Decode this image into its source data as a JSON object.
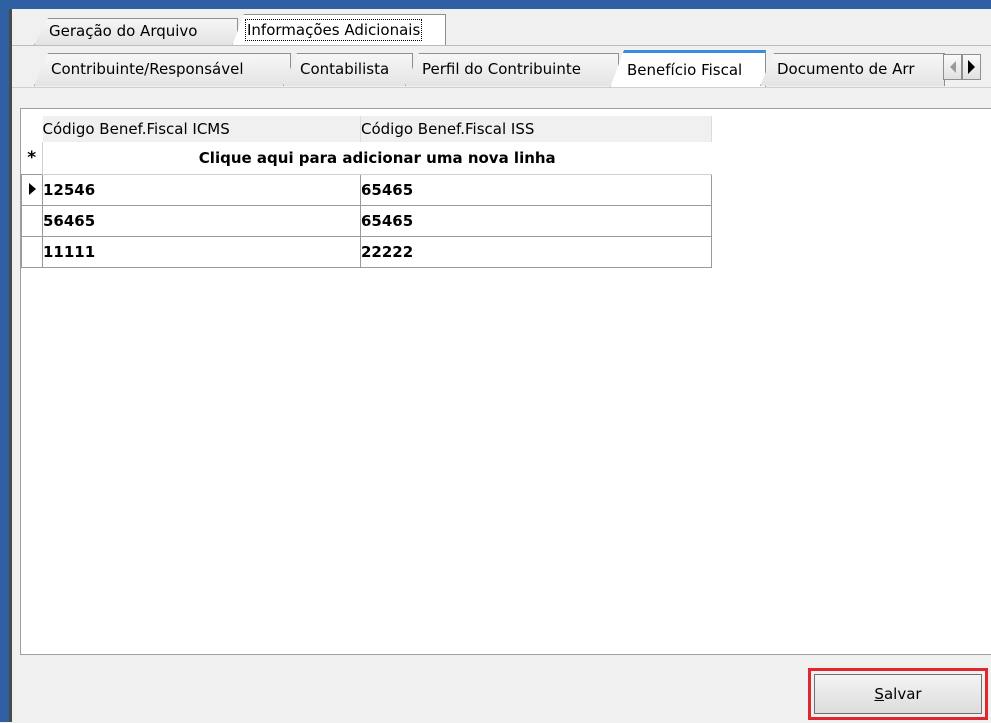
{
  "tabs_level1": [
    {
      "label": "Geração do Arquivo",
      "active": false
    },
    {
      "label": "Informações Adicionais",
      "active": true
    }
  ],
  "tabs_level2": [
    {
      "label": "Contribuinte/Responsável",
      "active": false
    },
    {
      "label": "Contabilista",
      "active": false
    },
    {
      "label": "Perfil do Contribuinte",
      "active": false
    },
    {
      "label": "Benefício Fiscal",
      "active": true
    },
    {
      "label": "Documento de Arr",
      "active": false
    }
  ],
  "tab_scroll": {
    "left_icon": "triangle-left-icon",
    "right_icon": "triangle-right-icon"
  },
  "grid": {
    "columns": [
      "Código Benef.Fiscal ICMS",
      "Código Benef.Fiscal ISS"
    ],
    "new_row_marker": "*",
    "new_row_text": "Clique aqui para adicionar uma nova linha",
    "rows": [
      [
        "12546",
        "65465"
      ],
      [
        "56465",
        "65465"
      ],
      [
        "11111",
        "22222"
      ]
    ],
    "current_row_index": 0
  },
  "actions": {
    "save_first_letter": "S",
    "save_rest": "alvar"
  },
  "colors": {
    "window_frame": "#2f60a3",
    "active_tab_accent": "#3a8ce0",
    "highlight_box": "#e0262e"
  }
}
